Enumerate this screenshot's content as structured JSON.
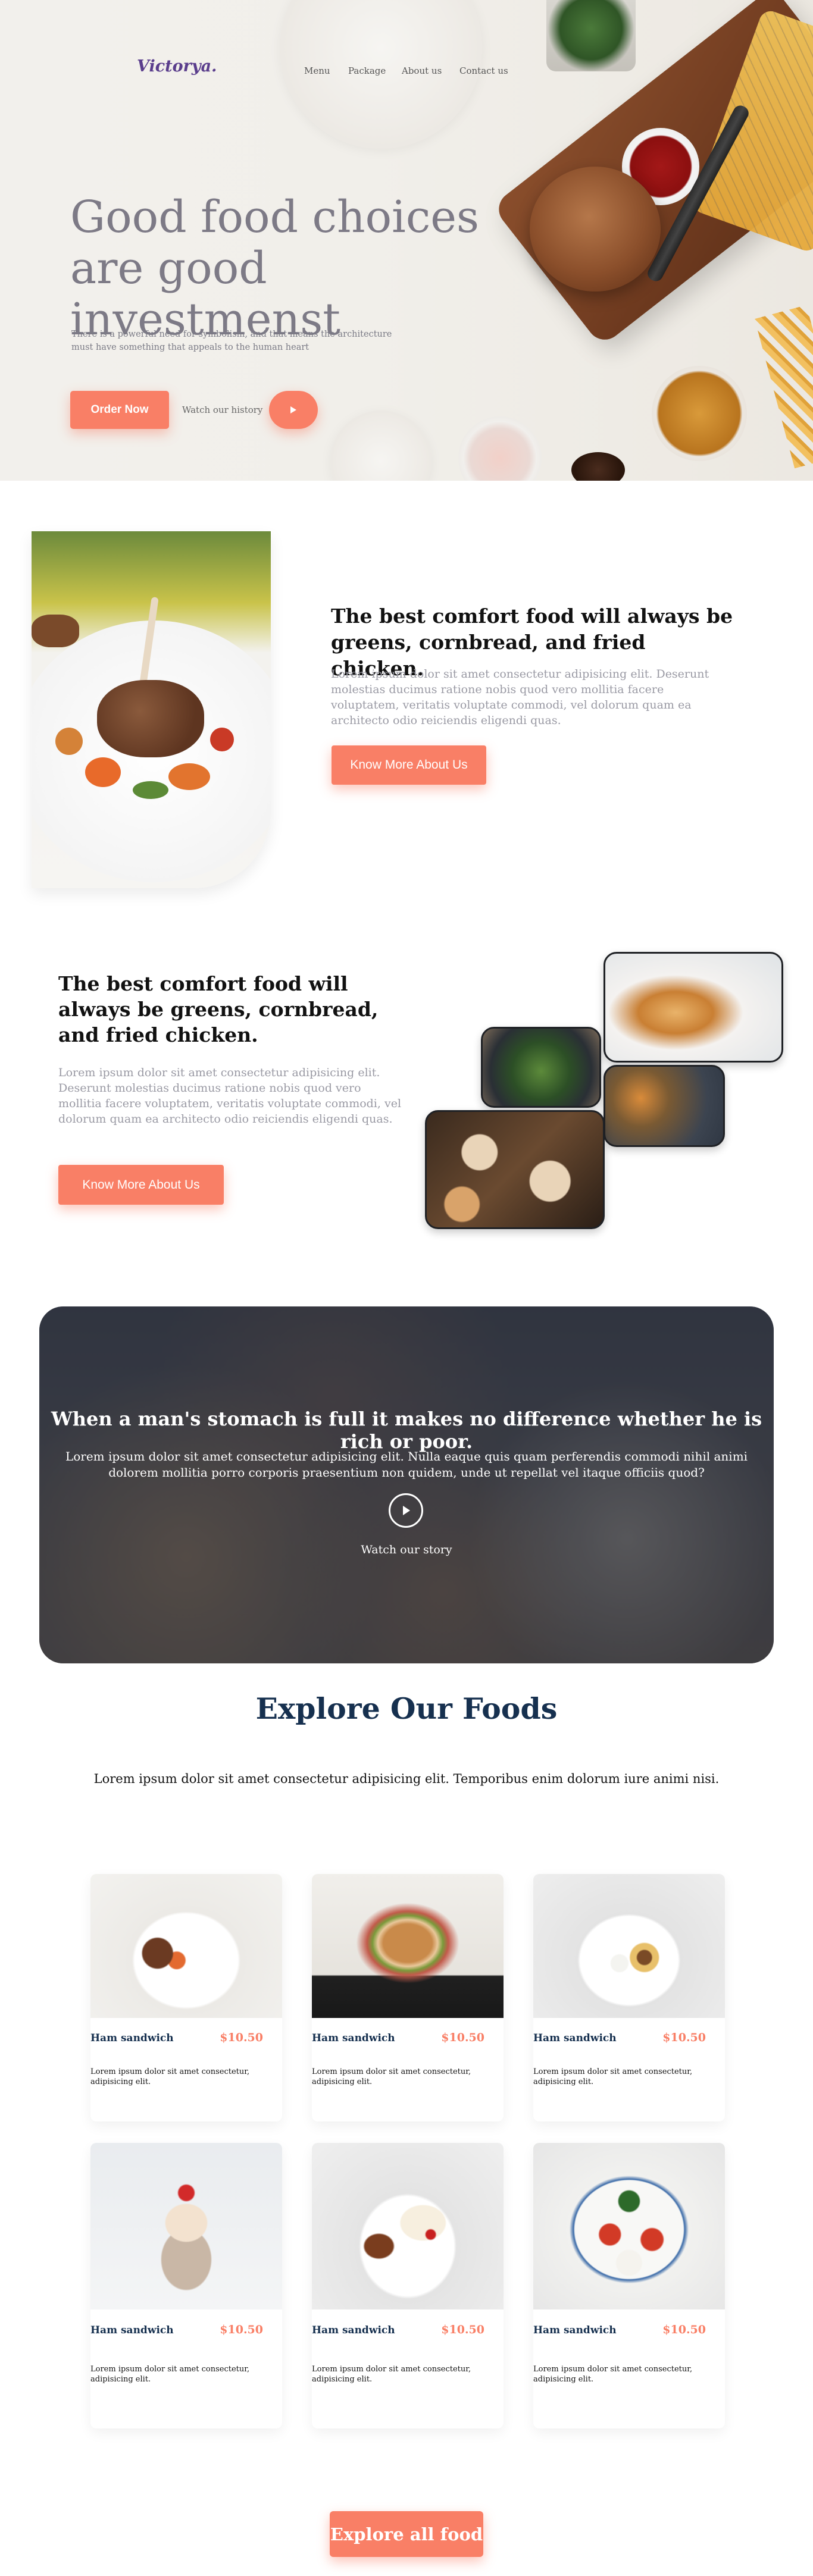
{
  "hero": {
    "logo": "Victorya.",
    "nav": [
      "Menu",
      "Package",
      "About us",
      "Contact us"
    ],
    "title": "Good food choices are good investmenst",
    "description": "There is a powerful need for symbolism, and that means the architecture must have something that appeals to the human heart",
    "order_label": "Order Now",
    "watch_label": "Watch our history",
    "play_icon": "play-icon",
    "accent": "#f97f66"
  },
  "about": {
    "title": "The best comfort food will always be greens, cornbread, and fried chicken.",
    "text": "Lorem ipsum dolor sit amet consectetur adipisicing elit. Deserunt molestias ducimus ratione nobis quod vero mollitia facere voluptatem, veritatis voluptate commodi, vel dolorum quam ea architecto odio reiciendis eligendi quas.",
    "button_label": "Know More About Us"
  },
  "about2": {
    "title": "The best comfort food will always be greens, cornbread, and fried chicken.",
    "text": "Lorem ipsum dolor sit amet consectetur adipisicing elit. Deserunt molestias ducimus ratione nobis quod vero mollitia facere voluptatem, veritatis voluptate commodi, vel dolorum quam ea architecto odio reiciendis eligendi quas.",
    "button_label": "Know More About Us"
  },
  "banner": {
    "title": "When a man's stomach is full it makes no difference whether he is rich or poor.",
    "text": "Lorem ipsum dolor sit amet consectetur adipisicing elit. Nulla eaque quis quam perferendis commodi nihil animi dolorem mollitia porro corporis praesentium non quidem, unde ut repellat vel itaque officiis quod?",
    "watch_label": "Watch our story"
  },
  "foods": {
    "title": "Explore Our Foods",
    "subtitle": "Lorem ipsum dolor sit amet consectetur adipisicing elit. Temporibus enim dolorum iure animi nisi.",
    "items": [
      {
        "name": "Ham sandwich",
        "price": "$10.50",
        "desc": "Lorem ipsum dolor sit amet consectetur, adipisicing elit."
      },
      {
        "name": "Ham sandwich",
        "price": "$10.50",
        "desc": "Lorem ipsum dolor sit amet consectetur, adipisicing elit."
      },
      {
        "name": "Ham sandwich",
        "price": "$10.50",
        "desc": "Lorem ipsum dolor sit amet consectetur, adipisicing elit."
      },
      {
        "name": "Ham sandwich",
        "price": "$10.50",
        "desc": "Lorem ipsum dolor sit amet consectetur, adipisicing elit."
      },
      {
        "name": "Ham sandwich",
        "price": "$10.50",
        "desc": "Lorem ipsum dolor sit amet consectetur, adipisicing elit."
      },
      {
        "name": "Ham sandwich",
        "price": "$10.50",
        "desc": "Lorem ipsum dolor sit amet consectetur, adipisicing elit."
      }
    ],
    "explore_label": "Explore all food"
  }
}
